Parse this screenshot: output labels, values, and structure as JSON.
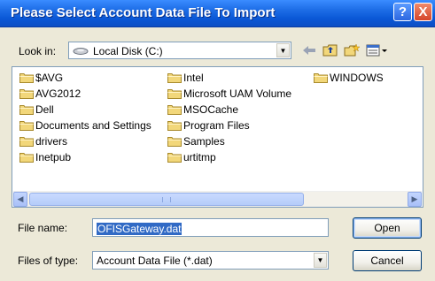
{
  "title": "Please Select Account Data File To Import",
  "titlebar": {
    "help_glyph": "?",
    "close_glyph": "X"
  },
  "look_in": {
    "label": "Look in:",
    "value": "Local Disk (C:)"
  },
  "folders": [
    {
      "name": "$AVG"
    },
    {
      "name": "AVG2012"
    },
    {
      "name": "Dell"
    },
    {
      "name": "Documents and Settings"
    },
    {
      "name": "drivers"
    },
    {
      "name": "Inetpub"
    },
    {
      "name": "Intel"
    },
    {
      "name": "Microsoft UAM Volume"
    },
    {
      "name": "MSOCache"
    },
    {
      "name": "Program Files"
    },
    {
      "name": "Samples"
    },
    {
      "name": "urtitmp"
    },
    {
      "name": "WINDOWS"
    }
  ],
  "file_name": {
    "label": "File name:",
    "value": "OFISGateway.dat"
  },
  "file_type": {
    "label": "Files of type:",
    "value": "Account Data File (*.dat)"
  },
  "buttons": {
    "open": "Open",
    "cancel": "Cancel"
  },
  "colors": {
    "title_blue": "#0a58d6",
    "selection": "#316ac5",
    "folder_yellow": "#f2d77a"
  }
}
